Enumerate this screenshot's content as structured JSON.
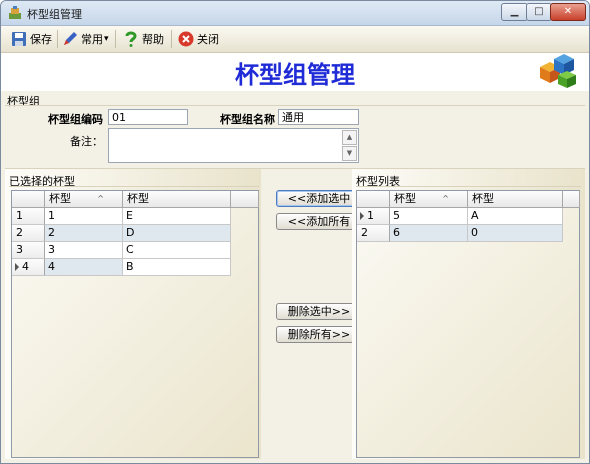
{
  "window": {
    "title": "杯型组管理",
    "min_glyph": "▁",
    "max_glyph": "□",
    "close_glyph": "✕"
  },
  "toolbar": {
    "save_label": "保存",
    "common_label": "常用",
    "common_dropdown": "▾",
    "help_label": "帮助",
    "close_label": "关闭"
  },
  "page_title": "杯型组管理",
  "group": {
    "label": "杯型组",
    "code_label": "杯型组编码",
    "code_value": "01",
    "name_label": "杯型组名称",
    "name_value": "通用",
    "remark_label": "备注："
  },
  "selected_panel": {
    "title": "已选择的杯型",
    "columns": [
      "杯型",
      "杯型"
    ],
    "sort_indicator": "^",
    "rows": [
      {
        "num": "1",
        "code": "1",
        "name": "E"
      },
      {
        "num": "2",
        "code": "2",
        "name": "D"
      },
      {
        "num": "3",
        "code": "3",
        "name": "C"
      },
      {
        "num": "4",
        "code": "4",
        "name": "B"
      }
    ]
  },
  "buttons": {
    "add_selected": "<<添加选中",
    "add_all": "<<添加所有",
    "remove_selected": "删除选中>>",
    "remove_all": "删除所有>>"
  },
  "list_panel": {
    "title": "杯型列表",
    "columns": [
      "杯型",
      "杯型"
    ],
    "sort_indicator": "^",
    "rows": [
      {
        "num": "1",
        "code": "5",
        "name": "A"
      },
      {
        "num": "2",
        "code": "6",
        "name": "0"
      }
    ]
  },
  "colors": {
    "title_blue": "#1f2bd6",
    "row_alt": "#dfe8ee",
    "panel_bg": "#e9e3cb"
  }
}
